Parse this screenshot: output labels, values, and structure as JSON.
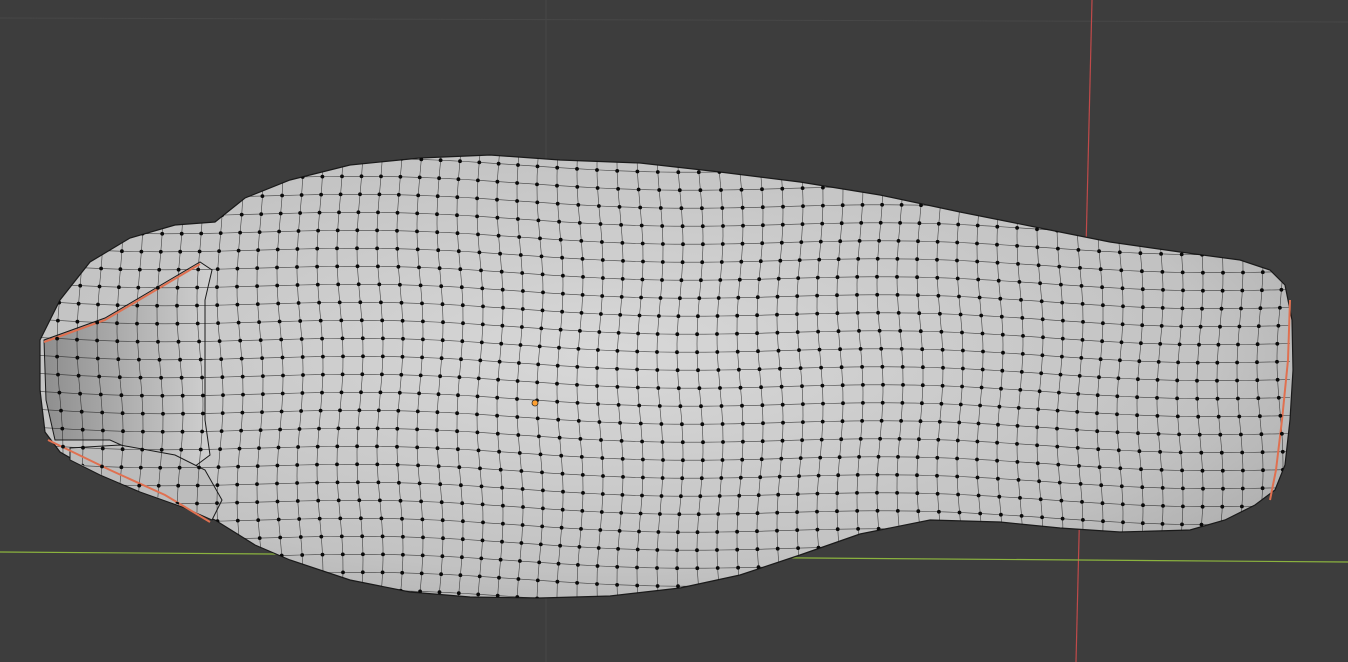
{
  "viewport": {
    "mode": "edit-mode",
    "view": "top",
    "background_color": "#3d3d3d",
    "grid_color": "#474747",
    "x_axis_color": "#8bb33e",
    "y_axis_color": "#c04a4a",
    "origin_color": "#ffa030"
  },
  "mesh": {
    "object": "sleeping-bag",
    "shading": "solid",
    "surface_color": "#c9c9c9",
    "wire_color": "#111111",
    "vertex_color": "#0a0a0a",
    "boundary_edge_color": "#e07050"
  }
}
